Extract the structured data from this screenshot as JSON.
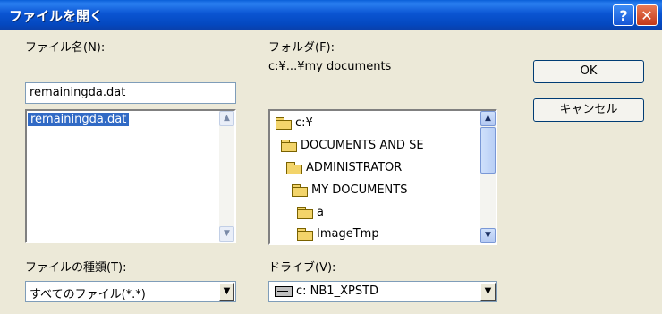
{
  "window": {
    "title": "ファイルを開く",
    "help_label": "?",
    "close_label": "✕"
  },
  "file_name": {
    "label": "ファイル名(N):",
    "value": "remainingda.dat"
  },
  "file_list": {
    "items": [
      "remainingda.dat"
    ]
  },
  "file_type": {
    "label": "ファイルの種類(T):",
    "value": "すべてのファイル(*.*)"
  },
  "folder": {
    "label": "フォルダ(F):",
    "path": "c:¥...¥my documents",
    "items": [
      "c:¥",
      "DOCUMENTS AND SE",
      "ADMINISTRATOR",
      "MY DOCUMENTS",
      "a",
      "ImageTmp"
    ]
  },
  "drive": {
    "label": "ドライブ(V):",
    "value": "c: NB1_XPSTD"
  },
  "buttons": {
    "ok": "OK",
    "cancel": "キャンセル"
  },
  "icons": {
    "folder": "folder-icon",
    "open_folder": "open-folder-icon",
    "drive": "drive-icon"
  }
}
